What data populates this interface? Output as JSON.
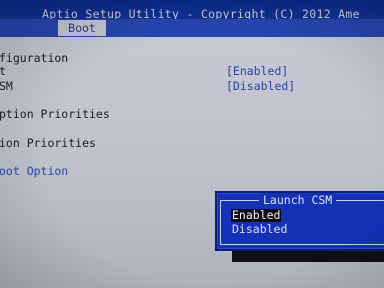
{
  "header": {
    "title": "Aptio Setup Utility - Copyright (C) 2012 Ame",
    "active_tab": "Boot"
  },
  "settings": [
    {
      "label": "figuration",
      "value": ""
    },
    {
      "label": "t",
      "value": "[Enabled]"
    },
    {
      "label": "SM",
      "value": "[Disabled]"
    },
    {
      "label": "ption Priorities",
      "value": ""
    },
    {
      "label": "ion Priorities",
      "value": ""
    },
    {
      "label": "oot Option",
      "value": ""
    }
  ],
  "popup": {
    "title": "Launch CSM",
    "options": [
      "Enabled",
      "Disabled"
    ],
    "selected": "Enabled"
  },
  "colors": {
    "header_bg": "#10308f",
    "body_bg": "#c2c5d0",
    "popup_bg": "#1432b8",
    "value_text": "#2c44a8",
    "highlight_bg": "#0c0c18"
  }
}
